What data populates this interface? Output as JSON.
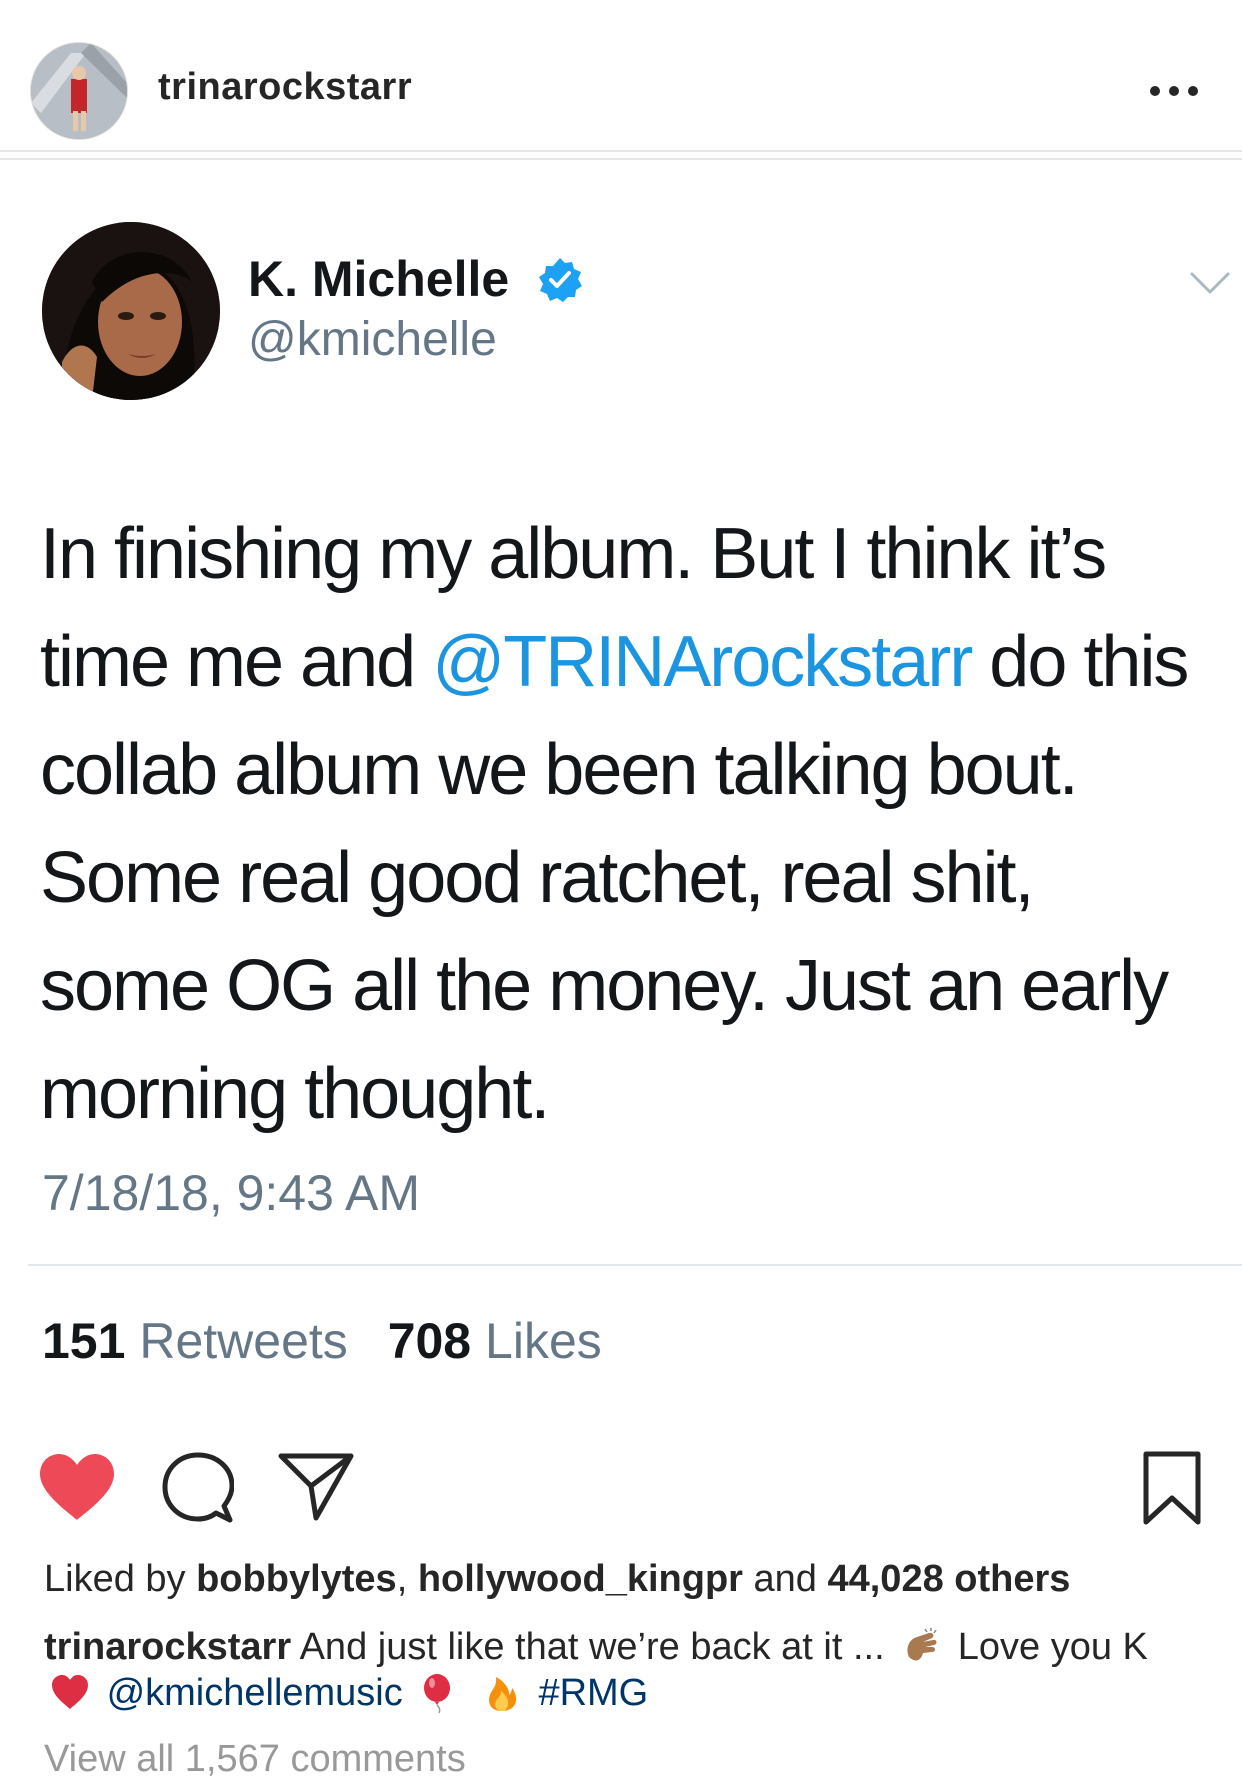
{
  "post": {
    "username": "trinarockstarr",
    "more_icon": "more-horizontal-icon"
  },
  "tweet": {
    "display_name": "K. Michelle",
    "handle": "@kmichelle",
    "verified_icon": "verified-badge-icon",
    "text_line1": "In finishing my album. But I think it’s",
    "text_line2_a": "time me and ",
    "text_line2_mention": "@TRINArockstarr",
    "text_line2_b": " do this",
    "text_line3": "collab album we been talking bout.",
    "text_line4": "Some real good ratchet, real shit,",
    "text_line5": "some OG all the money. Just an early",
    "text_line6": "morning thought.",
    "timestamp": "7/18/18, 9:43 AM",
    "retweets_count": "151",
    "retweets_label": "Retweets",
    "likes_count": "708",
    "likes_label": "Likes",
    "colors": {
      "name": "#14171a",
      "secondary": "#657786",
      "link": "#1b95e0",
      "verified": "#1da1f2"
    }
  },
  "actions": {
    "icons": [
      "heart-icon",
      "comment-icon",
      "share-icon",
      "bookmark-icon"
    ],
    "liked_color": "#ed4956"
  },
  "likes": {
    "prefix": "Liked by ",
    "user1": "bobbylytes",
    "sep": ", ",
    "user2": "hollywood_kingpr",
    "and": " and ",
    "others": "44,028 others"
  },
  "caption": {
    "username": "trinarockstarr",
    "text1": " And just like that we’re back at it ...",
    "text2": " Love you K",
    "mention": "@kmichellemusic",
    "hashtag": "#RMG",
    "emojis": [
      "clapping-hands-icon",
      "red-heart-icon",
      "balloon-icon",
      "fire-icon"
    ]
  },
  "comments": {
    "view_all": "View all 1,567 comments"
  }
}
